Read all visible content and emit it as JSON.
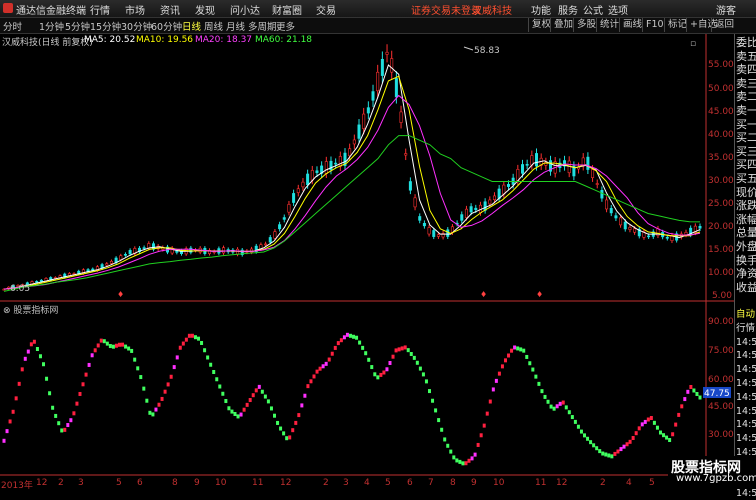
{
  "app": {
    "title": "通达信金融终端",
    "menu": [
      "行情",
      "市场",
      "资讯",
      "发现",
      "问小达",
      "财富圈",
      "交易"
    ],
    "alert": "证券交易未登录",
    "stock_name_top": "汉威科技",
    "right_menu": [
      "功能",
      "服务",
      "公式",
      "选项"
    ],
    "guest": "游客"
  },
  "periods": {
    "items": [
      "分时",
      "1分钟",
      "5分钟",
      "15分钟",
      "30分钟",
      "60分钟",
      "日线",
      "周线",
      "月线",
      "多周期",
      "更多"
    ],
    "active": "日线"
  },
  "right_tools": [
    "复权",
    "叠加",
    "多股",
    "统计",
    "画线",
    "F10",
    "标记",
    "+自选",
    "返回"
  ],
  "info": {
    "name": "汉威科技(日线 前复权)",
    "ma5": "MA5: 20.52",
    "ma10": "MA10: 19.56",
    "ma20": "MA20: 18.37",
    "ma60": "MA60: 21.18"
  },
  "price_axis": [
    "55.00",
    "50.00",
    "45.00",
    "40.00",
    "35.00",
    "30.00",
    "25.00",
    "20.00",
    "15.00",
    "10.00",
    "5.00"
  ],
  "max_label": "58.83",
  "min_label": "6.05",
  "indicator": {
    "title": "股票指标网",
    "axis": [
      "90.00",
      "75.00",
      "60.00",
      "45.00",
      "30.00"
    ],
    "current": "47.75"
  },
  "x_axis": [
    "2013年",
    "12",
    "2",
    "3",
    "5",
    "6",
    "8",
    "9",
    "10",
    "11",
    "12",
    "2",
    "3",
    "4",
    "5",
    "6",
    "7",
    "8",
    "9",
    "10",
    "11",
    "12",
    "2",
    "4",
    "5"
  ],
  "right_panel": [
    "委比",
    "卖五",
    "卖四",
    "卖三",
    "卖二",
    "卖一",
    "买一",
    "买二",
    "买三",
    "买四",
    "买五",
    "现价",
    "涨跌",
    "涨幅",
    "总量",
    "外盘",
    "换手",
    "净资",
    "收益",
    "自动",
    "行情",
    "14:50",
    "14:50",
    "14:50",
    "14:50",
    "14:50",
    "14:50",
    "14:50",
    "14:50",
    "14:50",
    "14:50",
    "14:50",
    "14:50"
  ],
  "watermark": {
    "line1": "股票指标网",
    "line2": "www.7gpzb.com"
  },
  "colors": {
    "ma5": "#ffffff",
    "ma10": "#ffff00",
    "ma20": "#ff00ff",
    "ma60": "#00ff00",
    "up": "#ff3030",
    "down": "#00ffff",
    "kdj_red": "#ff2040",
    "kdj_green": "#40ff60",
    "kdj_magenta": "#ff30ff"
  },
  "chart_data": {
    "type": "line",
    "price_series": [
      6.5,
      7,
      7.5,
      8,
      8.5,
      9,
      9.5,
      10,
      10.5,
      11,
      12,
      13,
      14.5,
      15,
      16,
      15.5,
      15,
      14.5,
      15,
      15,
      14.5,
      15,
      14.8,
      14.5,
      15,
      16,
      18,
      22,
      27,
      30,
      32,
      33,
      34,
      35,
      40,
      45,
      52,
      58.83,
      48,
      30,
      22,
      19,
      18,
      19,
      22,
      24,
      24,
      26,
      28,
      30,
      33,
      35,
      34,
      33,
      34,
      32,
      35,
      30,
      25,
      22,
      20,
      19,
      18,
      19,
      17.5,
      18,
      19,
      20
    ],
    "ma60_series": [
      6,
      6.5,
      7,
      7.3,
      7.6,
      8,
      8.3,
      8.6,
      9,
      9.5,
      10,
      10.5,
      11,
      11.5,
      12,
      12.3,
      12.5,
      12.8,
      13,
      13.3,
      13.5,
      13.8,
      14,
      14.2,
      14.4,
      14.6,
      15.5,
      17,
      19,
      21,
      23,
      25,
      27,
      29,
      31,
      33,
      35,
      38,
      40,
      40,
      39,
      38,
      36,
      35,
      33,
      32,
      31,
      30,
      30,
      30,
      30,
      30,
      30,
      30,
      30,
      30,
      29,
      28,
      27,
      26,
      25,
      24,
      23,
      22.5,
      22,
      21.5,
      21.2,
      21.18
    ],
    "ylim": [
      5,
      60
    ],
    "indicator_series": [
      20,
      40,
      70,
      85,
      70,
      40,
      25,
      35,
      55,
      75,
      85,
      80,
      82,
      78,
      60,
      35,
      45,
      60,
      80,
      88,
      85,
      70,
      55,
      40,
      35,
      45,
      55,
      45,
      30,
      20,
      35,
      55,
      65,
      70,
      82,
      88,
      86,
      75,
      60,
      65,
      78,
      80,
      72,
      60,
      40,
      20,
      8,
      5,
      10,
      30,
      55,
      70,
      80,
      78,
      65,
      50,
      40,
      45,
      35,
      25,
      18,
      12,
      10,
      15,
      20,
      30,
      35,
      25,
      20,
      40,
      55,
      47.75
    ],
    "indicator_ylim": [
      0,
      100
    ]
  }
}
